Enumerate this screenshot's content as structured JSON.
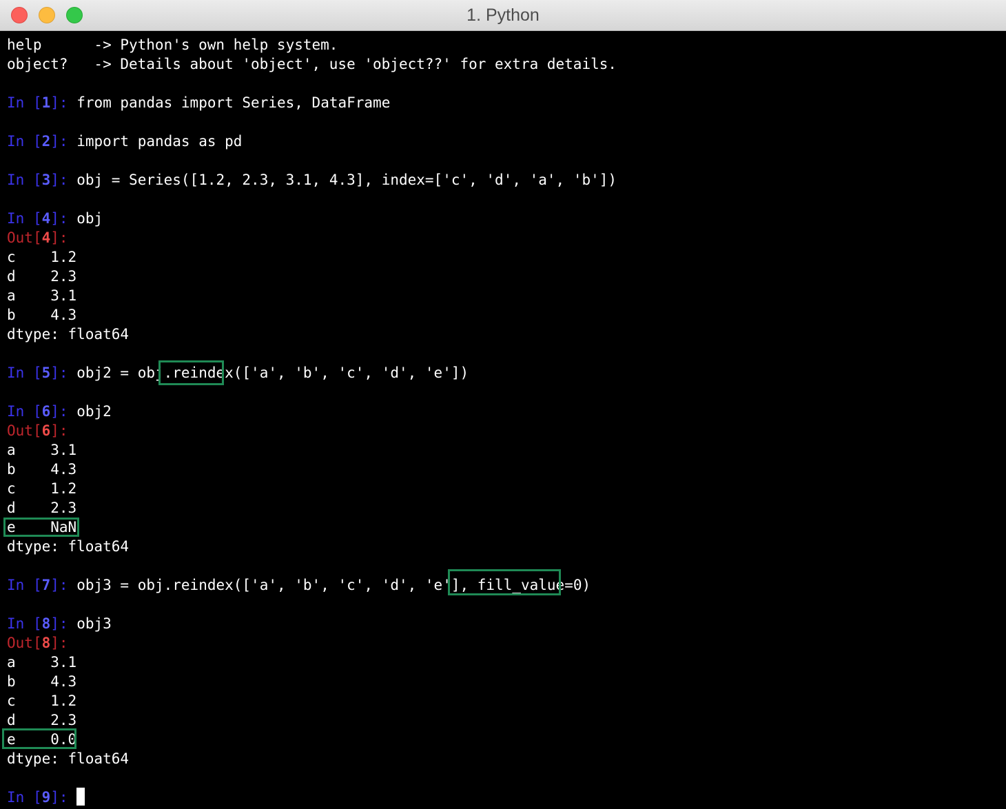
{
  "window": {
    "title": "1. Python"
  },
  "terminal": {
    "lines": [
      {
        "type": "text",
        "text": "help      -> Python's own help system."
      },
      {
        "type": "text",
        "text": "object?   -> Details about 'object', use 'object??' for extra details."
      },
      {
        "type": "blank"
      },
      {
        "type": "in",
        "n": "1",
        "code": "from pandas import Series, DataFrame"
      },
      {
        "type": "blank"
      },
      {
        "type": "in",
        "n": "2",
        "code": "import pandas as pd"
      },
      {
        "type": "blank"
      },
      {
        "type": "in",
        "n": "3",
        "code": "obj = Series([1.2, 2.3, 3.1, 4.3], index=['c', 'd', 'a', 'b'])"
      },
      {
        "type": "blank"
      },
      {
        "type": "in",
        "n": "4",
        "code": "obj"
      },
      {
        "type": "out",
        "n": "4"
      },
      {
        "type": "text",
        "text": "c    1.2"
      },
      {
        "type": "text",
        "text": "d    2.3"
      },
      {
        "type": "text",
        "text": "a    3.1"
      },
      {
        "type": "text",
        "text": "b    4.3"
      },
      {
        "type": "text",
        "text": "dtype: float64"
      },
      {
        "type": "blank"
      },
      {
        "type": "in",
        "n": "5",
        "code": "obj2 = obj.reindex(['a', 'b', 'c', 'd', 'e'])"
      },
      {
        "type": "blank"
      },
      {
        "type": "in",
        "n": "6",
        "code": "obj2"
      },
      {
        "type": "out",
        "n": "6"
      },
      {
        "type": "text",
        "text": "a    3.1"
      },
      {
        "type": "text",
        "text": "b    4.3"
      },
      {
        "type": "text",
        "text": "c    1.2"
      },
      {
        "type": "text",
        "text": "d    2.3"
      },
      {
        "type": "text",
        "text": "e    NaN"
      },
      {
        "type": "text",
        "text": "dtype: float64"
      },
      {
        "type": "blank"
      },
      {
        "type": "in",
        "n": "7",
        "code": "obj3 = obj.reindex(['a', 'b', 'c', 'd', 'e'], fill_value=0)"
      },
      {
        "type": "blank"
      },
      {
        "type": "in",
        "n": "8",
        "code": "obj3"
      },
      {
        "type": "out",
        "n": "8"
      },
      {
        "type": "text",
        "text": "a    3.1"
      },
      {
        "type": "text",
        "text": "b    4.3"
      },
      {
        "type": "text",
        "text": "c    1.2"
      },
      {
        "type": "text",
        "text": "d    2.3"
      },
      {
        "type": "text",
        "text": "e    0.0"
      },
      {
        "type": "text",
        "text": "dtype: float64"
      },
      {
        "type": "blank"
      },
      {
        "type": "prompt",
        "n": "9"
      }
    ],
    "prompt_in_word": "In",
    "prompt_out_word": "Out"
  },
  "colors": {
    "background": "#000000",
    "text": "#ffffff",
    "in_prompt": "#3b33ea",
    "out_prompt": "#c0262d",
    "highlight_box": "#1f8a55"
  }
}
